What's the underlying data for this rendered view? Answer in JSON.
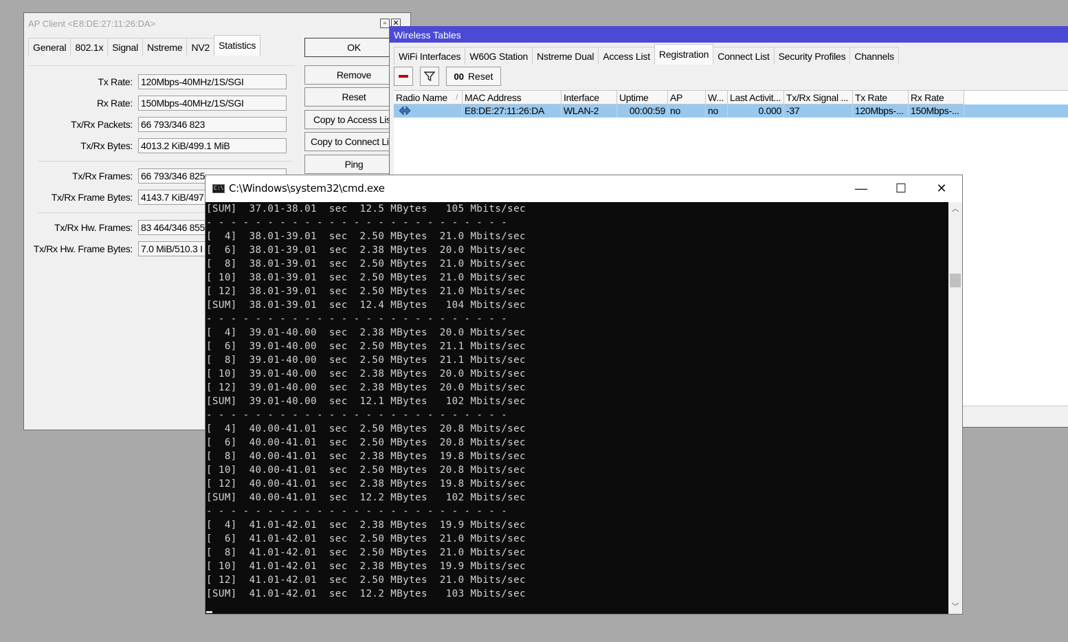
{
  "ap_client": {
    "title": "AP Client <E8:DE:27:11:26:DA>",
    "tabs": [
      "General",
      "802.1x",
      "Signal",
      "Nstreme",
      "NV2",
      "Statistics"
    ],
    "active_tab": "Statistics",
    "fields": [
      {
        "label": "Tx Rate:",
        "value": "120Mbps-40MHz/1S/SGI"
      },
      {
        "label": "Rx Rate:",
        "value": "150Mbps-40MHz/1S/SGI"
      },
      {
        "label": "Tx/Rx Packets:",
        "value": "66 793/346 823"
      },
      {
        "label": "Tx/Rx Bytes:",
        "value": "4013.2 KiB/499.1 MiB"
      },
      {
        "label": "Tx/Rx Frames:",
        "value": "66 793/346 825"
      },
      {
        "label": "Tx/Rx Frame Bytes:",
        "value": "4143.7 KiB/497"
      },
      {
        "label": "Tx/Rx Hw. Frames:",
        "value": "83 464/346 855"
      },
      {
        "label": "Tx/Rx Hw. Frame Bytes:",
        "value": "7.0 MiB/510.3 I"
      }
    ],
    "buttons": [
      "OK",
      "Remove",
      "Reset",
      "Copy to Access List",
      "Copy to Connect List",
      "Ping"
    ]
  },
  "wireless_tables": {
    "title": "Wireless Tables",
    "tabs": [
      "WiFi Interfaces",
      "W60G Station",
      "Nstreme Dual",
      "Access List",
      "Registration",
      "Connect List",
      "Security Profiles",
      "Channels"
    ],
    "active_tab": "Registration",
    "toolbar": {
      "reset_prefix": "00",
      "reset_label": "Reset"
    },
    "columns": [
      "Radio Name",
      "MAC Address",
      "Interface",
      "Uptime",
      "AP",
      "W...",
      "Last Activit...",
      "Tx/Rx Signal ...",
      "Tx Rate",
      "Rx Rate"
    ],
    "sort_marker": "/",
    "rows": [
      {
        "radio_name": "",
        "mac": "E8:DE:27:11:26:DA",
        "interface": "WLAN-2",
        "uptime": "00:00:59",
        "ap": "no",
        "wds": "no",
        "last_activity": "0.000",
        "signal": "-37",
        "tx_rate": "120Mbps-...",
        "rx_rate": "150Mbps-..."
      }
    ]
  },
  "cmd": {
    "title": "C:\\Windows\\system32\\cmd.exe",
    "icon_text": "C:\\",
    "controls": {
      "minimize": "—",
      "maximize": "☐",
      "close": "✕"
    },
    "lines": [
      "[SUM]  37.01-38.01  sec  12.5 MBytes   105 Mbits/sec",
      "- - - - - - - - - - - - - - - - - - - - - - - - -",
      "[  4]  38.01-39.01  sec  2.50 MBytes  21.0 Mbits/sec",
      "[  6]  38.01-39.01  sec  2.38 MBytes  20.0 Mbits/sec",
      "[  8]  38.01-39.01  sec  2.50 MBytes  21.0 Mbits/sec",
      "[ 10]  38.01-39.01  sec  2.50 MBytes  21.0 Mbits/sec",
      "[ 12]  38.01-39.01  sec  2.50 MBytes  21.0 Mbits/sec",
      "[SUM]  38.01-39.01  sec  12.4 MBytes   104 Mbits/sec",
      "- - - - - - - - - - - - - - - - - - - - - - - - -",
      "[  4]  39.01-40.00  sec  2.38 MBytes  20.0 Mbits/sec",
      "[  6]  39.01-40.00  sec  2.50 MBytes  21.1 Mbits/sec",
      "[  8]  39.01-40.00  sec  2.50 MBytes  21.1 Mbits/sec",
      "[ 10]  39.01-40.00  sec  2.38 MBytes  20.0 Mbits/sec",
      "[ 12]  39.01-40.00  sec  2.38 MBytes  20.0 Mbits/sec",
      "[SUM]  39.01-40.00  sec  12.1 MBytes   102 Mbits/sec",
      "- - - - - - - - - - - - - - - - - - - - - - - - -",
      "[  4]  40.00-41.01  sec  2.50 MBytes  20.8 Mbits/sec",
      "[  6]  40.00-41.01  sec  2.50 MBytes  20.8 Mbits/sec",
      "[  8]  40.00-41.01  sec  2.38 MBytes  19.8 Mbits/sec",
      "[ 10]  40.00-41.01  sec  2.50 MBytes  20.8 Mbits/sec",
      "[ 12]  40.00-41.01  sec  2.38 MBytes  19.8 Mbits/sec",
      "[SUM]  40.00-41.01  sec  12.2 MBytes   102 Mbits/sec",
      "- - - - - - - - - - - - - - - - - - - - - - - - -",
      "[  4]  41.01-42.01  sec  2.38 MBytes  19.9 Mbits/sec",
      "[  6]  41.01-42.01  sec  2.50 MBytes  21.0 Mbits/sec",
      "[  8]  41.01-42.01  sec  2.50 MBytes  21.0 Mbits/sec",
      "[ 10]  41.01-42.01  sec  2.38 MBytes  19.9 Mbits/sec",
      "[ 12]  41.01-42.01  sec  2.50 MBytes  21.0 Mbits/sec",
      "[SUM]  41.01-42.01  sec  12.2 MBytes   103 Mbits/sec"
    ]
  },
  "colors": {
    "desktop": "#a9a9a9",
    "wt_titlebar": "#4a4ad4",
    "selected_row": "#99c8ee",
    "console_bg": "#0c0c0c",
    "console_text": "#d4d4d4",
    "remove_icon": "#c00000"
  },
  "icons": {
    "remove": "minus-icon",
    "filter": "funnel-icon",
    "registration_row": "wireless-client-icon",
    "scroll_up": "chevron-up-icon",
    "scroll_down": "chevron-down-icon"
  }
}
